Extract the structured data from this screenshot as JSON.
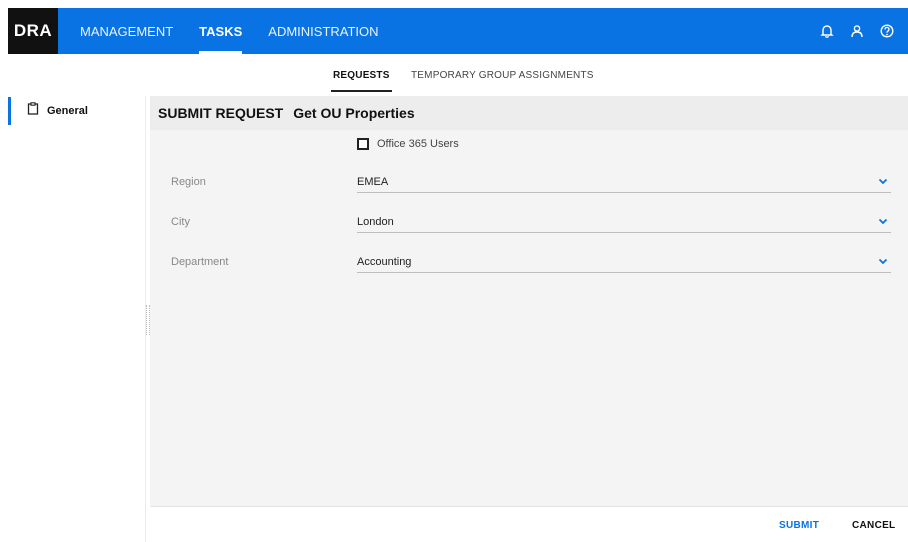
{
  "app": {
    "logo": "DRA"
  },
  "nav": {
    "items": [
      {
        "label": "MANAGEMENT",
        "active": false
      },
      {
        "label": "TASKS",
        "active": true
      },
      {
        "label": "ADMINISTRATION",
        "active": false
      }
    ],
    "icons": [
      "bell-icon",
      "user-icon",
      "help-icon"
    ],
    "accent_color": "#0a73e3"
  },
  "subtabs": [
    {
      "label": "REQUESTS",
      "active": true
    },
    {
      "label": "TEMPORARY GROUP ASSIGNMENTS",
      "active": false
    }
  ],
  "sidebar": {
    "items": [
      {
        "label": "General",
        "icon": "clipboard-icon",
        "active": true
      }
    ]
  },
  "form": {
    "header_prefix": "SUBMIT REQUEST",
    "header_title": "Get OU Properties",
    "checkbox": {
      "label": "Office 365 Users",
      "checked": false
    },
    "fields": [
      {
        "label": "Region",
        "value": "EMEA"
      },
      {
        "label": "City",
        "value": "London"
      },
      {
        "label": "Department",
        "value": "Accounting"
      }
    ]
  },
  "footer": {
    "submit_label": "SUBMIT",
    "cancel_label": "CANCEL"
  }
}
